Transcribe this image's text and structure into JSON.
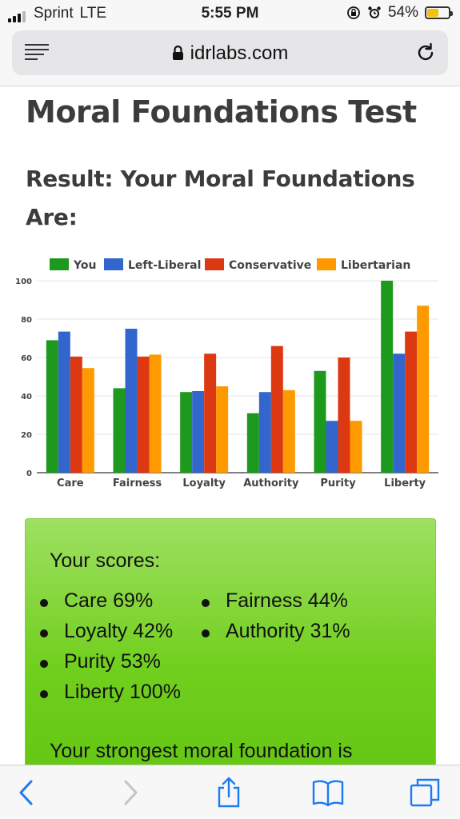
{
  "status": {
    "carrier": "Sprint",
    "network": "LTE",
    "time": "5:55 PM",
    "battery": "54%",
    "battery_fraction": 0.54,
    "icons": [
      "signal-icon",
      "orientation-lock-icon",
      "alarm-icon",
      "battery-icon"
    ]
  },
  "browser": {
    "url": "idrlabs.com",
    "icons": [
      "menu-icon",
      "lock-icon",
      "reload-icon"
    ]
  },
  "page": {
    "title": "Moral Foundations Test",
    "result_heading": "Result: Your Moral Foundations Are:"
  },
  "chart_data": {
    "type": "bar",
    "categories": [
      "Care",
      "Fairness",
      "Loyalty",
      "Authority",
      "Purity",
      "Liberty"
    ],
    "series": [
      {
        "name": "You",
        "color": "#1d9a1d",
        "values": [
          69,
          44,
          42,
          31,
          53,
          100
        ]
      },
      {
        "name": "Left-Liberal",
        "color": "#3366cc",
        "values": [
          73.5,
          75,
          42.5,
          42,
          27,
          62
        ]
      },
      {
        "name": "Conservative",
        "color": "#dc3912",
        "values": [
          60.5,
          60.5,
          62,
          66,
          60,
          73.5
        ]
      },
      {
        "name": "Libertarian",
        "color": "#ff9900",
        "values": [
          54.5,
          61.5,
          45,
          43,
          27,
          87
        ]
      }
    ],
    "ylim": [
      0,
      100
    ],
    "yticks": [
      "0",
      "20",
      "40",
      "60",
      "80",
      "100"
    ],
    "title": "",
    "xlabel": "",
    "ylabel": "",
    "legend_position": "top",
    "grid": true
  },
  "scores": {
    "title": "Your scores:",
    "items": [
      "Care 69%",
      "Fairness 44%",
      "Loyalty 42%",
      "Authority 31%",
      "Purity 53%",
      "Liberty 100%"
    ],
    "strongest_text": "Your strongest moral foundation is"
  },
  "toolbar": {
    "icons": [
      "back-icon",
      "forward-icon",
      "share-icon",
      "bookmarks-icon",
      "tabs-icon"
    ]
  }
}
